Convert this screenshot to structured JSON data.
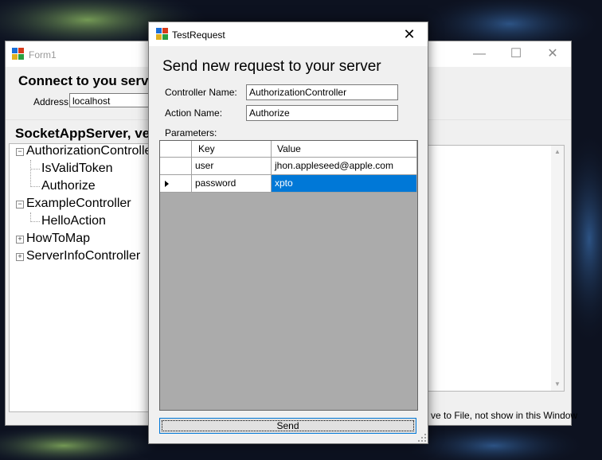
{
  "form1": {
    "title": "Form1",
    "connect_title": "Connect to you serve",
    "address_label": "Address",
    "address_value": "localhost",
    "server_title": "SocketAppServer, ve",
    "tree": [
      {
        "label": "AuthorizationControlle",
        "expanded": true
      },
      {
        "label": "IsValidToken"
      },
      {
        "label": "Authorize"
      },
      {
        "label": "ExampleController",
        "expanded": true
      },
      {
        "label": "HelloAction"
      },
      {
        "label": "HowToMap",
        "expanded": false
      },
      {
        "label": "ServerInfoController",
        "expanded": false
      }
    ],
    "save_label": "ve to File, not show in this Window"
  },
  "dialog": {
    "title": "TestRequest",
    "heading": "Send new request to your server",
    "controller_label": "Controller Name:",
    "controller_value": "AuthorizationController",
    "action_label": "Action Name:",
    "action_value": "Authorize",
    "parameters_label": "Parameters:",
    "grid": {
      "headers": [
        "Key",
        "Value"
      ],
      "rows": [
        {
          "key": "user",
          "value": "jhon.appleseed@apple.com"
        },
        {
          "key": "password",
          "value": "xpto"
        }
      ]
    },
    "send_label": "Send"
  },
  "icons": [
    "app-icon",
    "minimize-icon",
    "maximize-icon",
    "close-icon",
    "collapse-icon",
    "expand-icon",
    "row-arrow-icon",
    "resize-grip-icon"
  ],
  "colors": {
    "selection": "#0078d7",
    "grid_background": "#ababab",
    "window": "#f0f0f0"
  }
}
